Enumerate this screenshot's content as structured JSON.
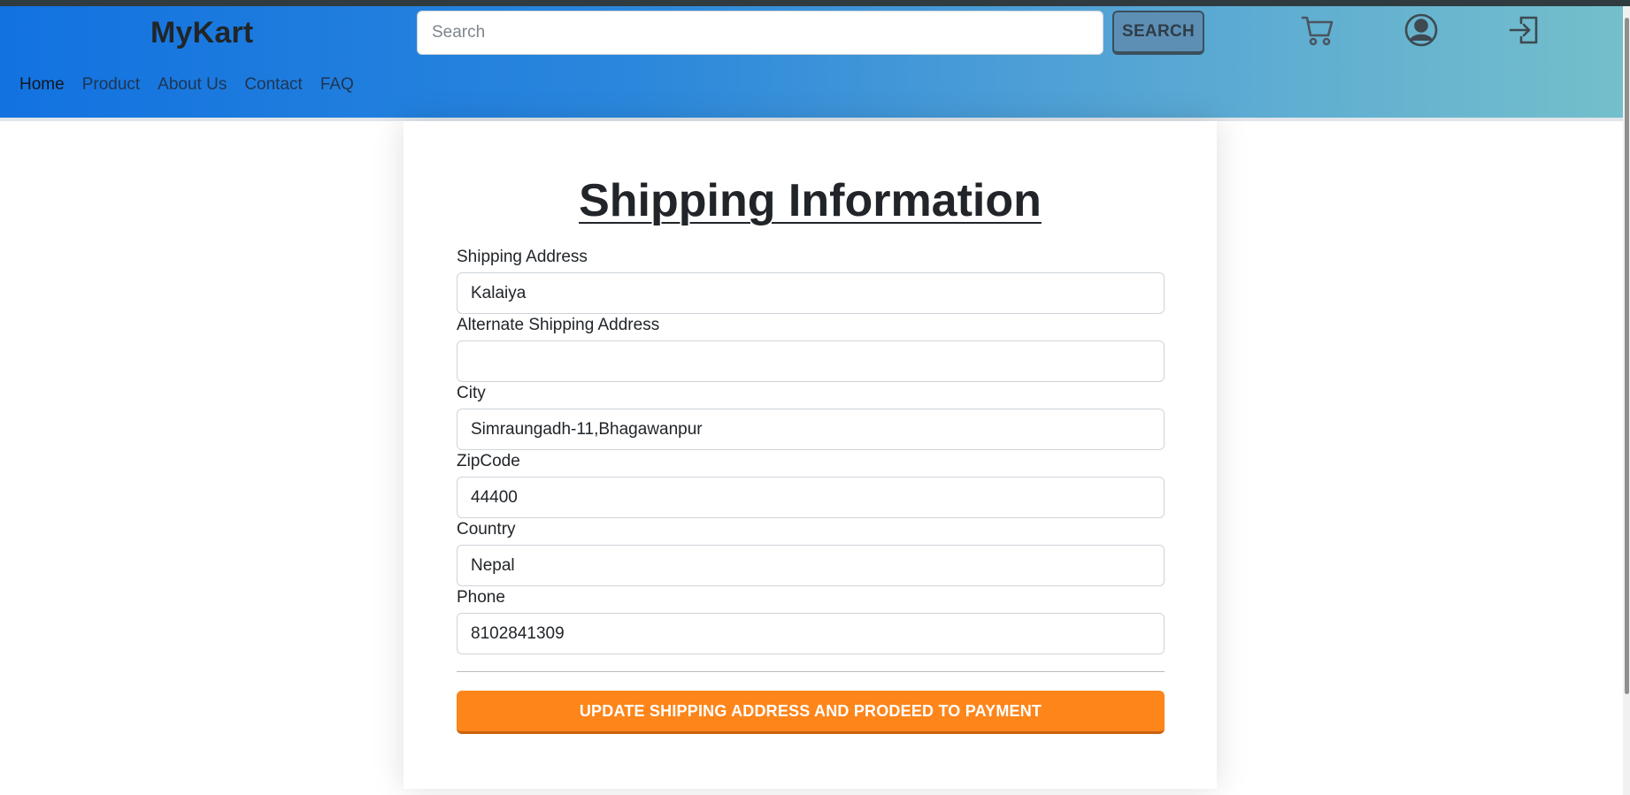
{
  "header": {
    "brand": "MyKart",
    "search": {
      "placeholder": "Search",
      "value": ""
    },
    "search_button": "SEARCH",
    "icons": [
      "cart-icon",
      "user-account-icon",
      "login-icon"
    ],
    "nav": [
      {
        "label": "Home",
        "active": true
      },
      {
        "label": "Product"
      },
      {
        "label": "About Us"
      },
      {
        "label": "Contact"
      },
      {
        "label": "FAQ"
      }
    ]
  },
  "form": {
    "title": "Shipping Information",
    "fields": [
      {
        "label": "Shipping Address",
        "value": "Kalaiya"
      },
      {
        "label": "Alternate Shipping Address",
        "value": ""
      },
      {
        "label": "City",
        "value": "Simraungadh-11,Bhagawanpur"
      },
      {
        "label": "ZipCode",
        "value": "44400"
      },
      {
        "label": "Country",
        "value": "Nepal"
      },
      {
        "label": "Phone",
        "value": "8102841309"
      }
    ],
    "submit_label": "UPDATE SHIPPING ADDRESS AND PRODEED TO PAYMENT"
  },
  "colors": {
    "header_gradient_start": "#1272e0",
    "header_gradient_end": "#74bfcb",
    "submit_button": "#fd851a",
    "search_button": "#5d8fb5"
  }
}
